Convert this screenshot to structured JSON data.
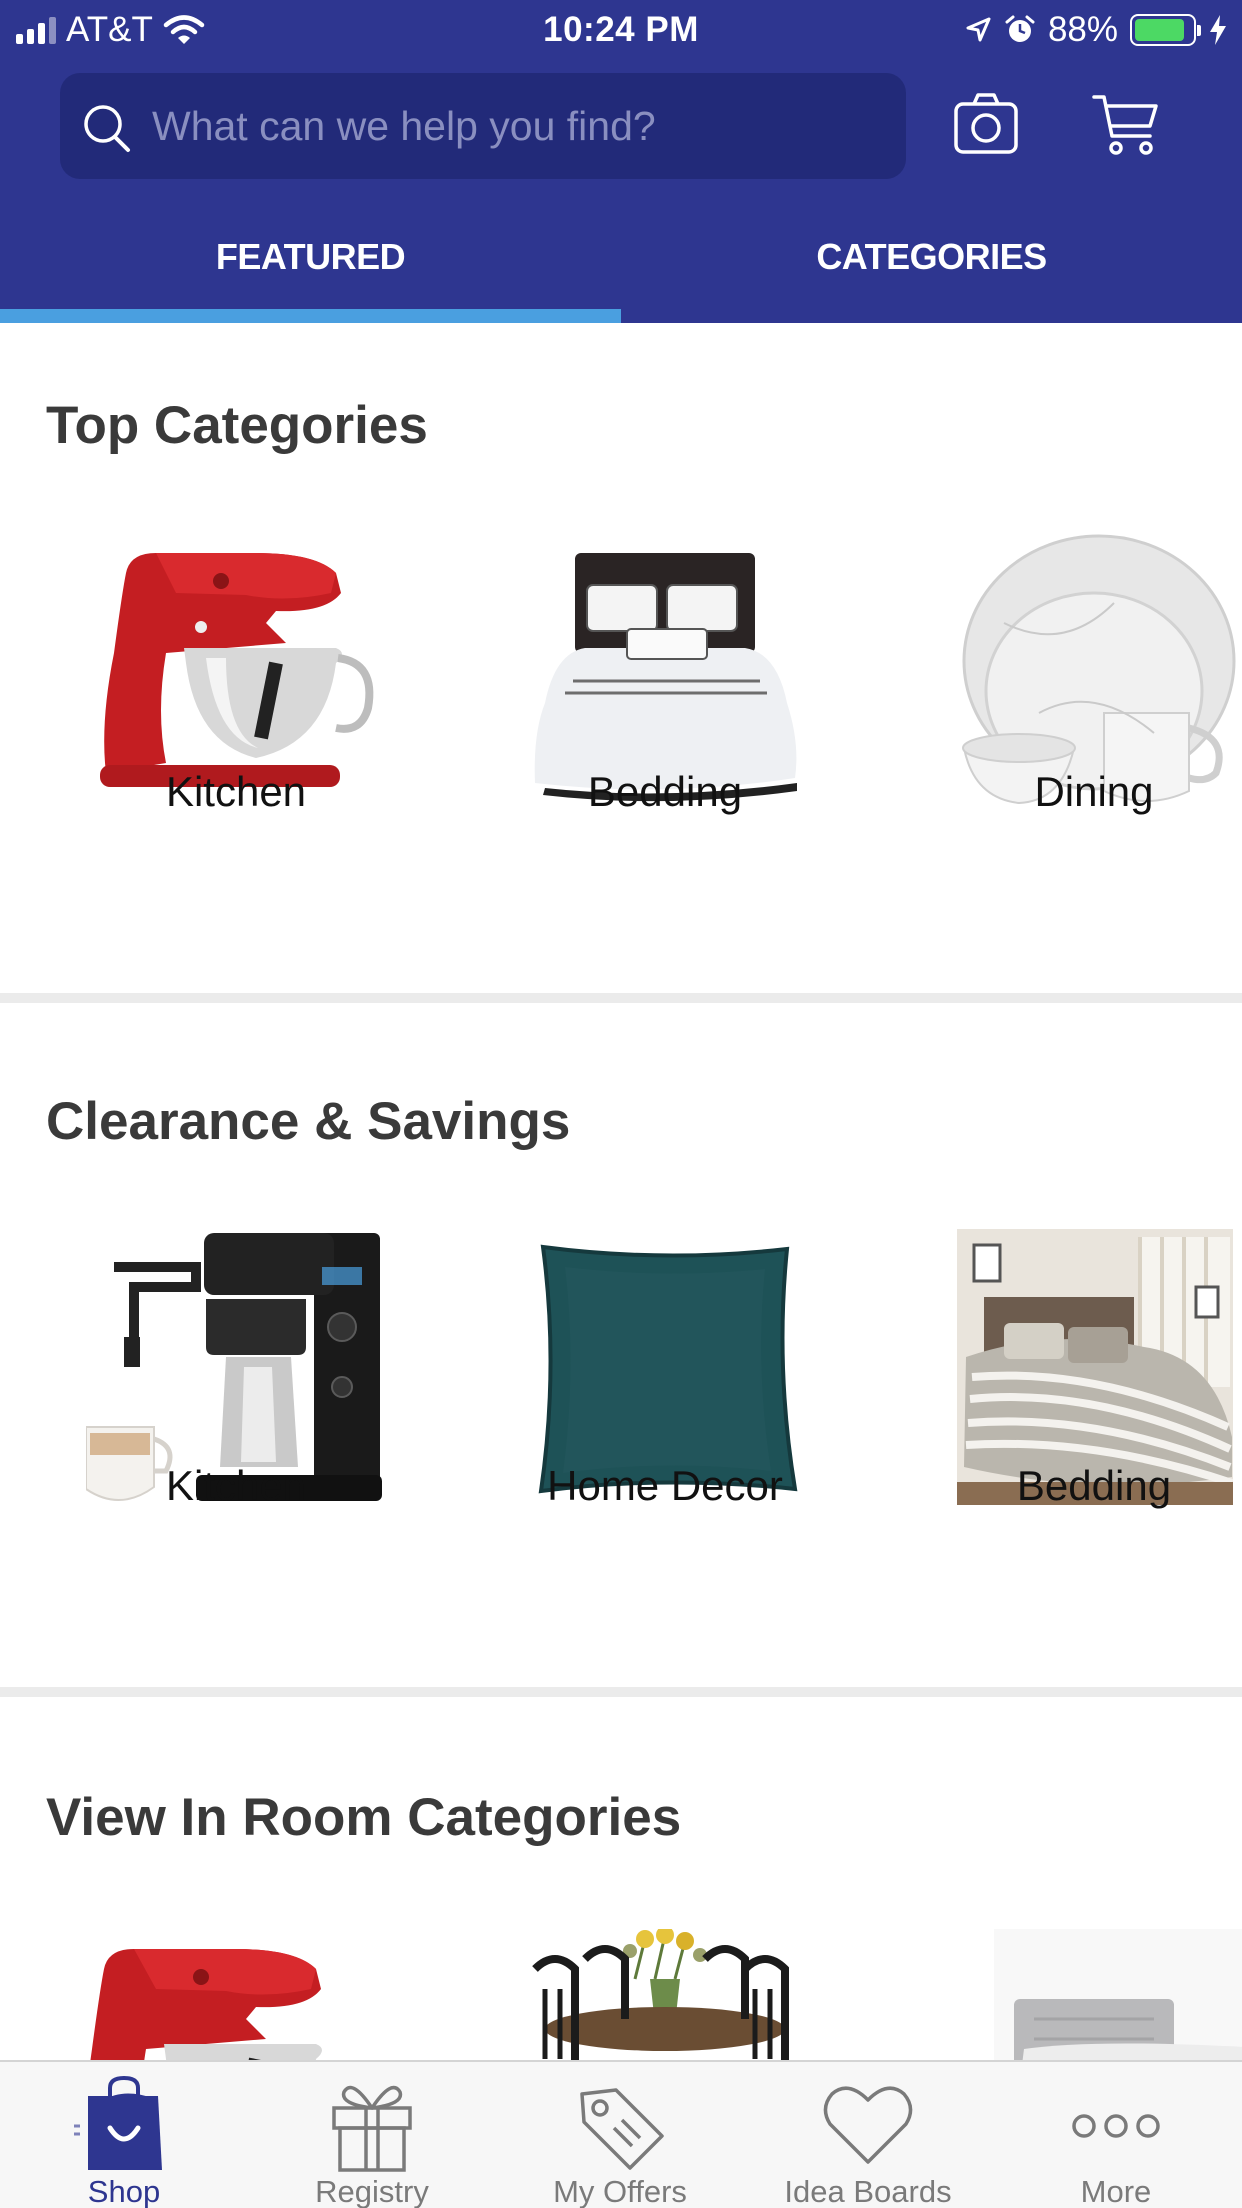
{
  "status_bar": {
    "carrier": "AT&T",
    "time": "10:24 PM",
    "battery_percent": "88%",
    "battery_level": 0.88
  },
  "search": {
    "placeholder": "What can we help you find?"
  },
  "tabs": [
    {
      "label": "FEATURED",
      "active": true
    },
    {
      "label": "CATEGORIES",
      "active": false
    }
  ],
  "sections": {
    "top_categories": {
      "title": "Top Categories",
      "items": [
        {
          "label": "Kitchen",
          "image": "stand-mixer"
        },
        {
          "label": "Bedding",
          "image": "bed"
        },
        {
          "label": "Dining",
          "image": "dinnerware"
        }
      ]
    },
    "clearance": {
      "title": "Clearance & Savings",
      "items": [
        {
          "label": "Kitchen",
          "image": "coffee-maker"
        },
        {
          "label": "Home Decor",
          "image": "pillow"
        },
        {
          "label": "Bedding",
          "image": "bedroom"
        }
      ]
    },
    "view_in_room": {
      "title": "View In Room Categories",
      "items": [
        {
          "image": "stand-mixer"
        },
        {
          "image": "dining-set"
        },
        {
          "image": "headboard-bed"
        }
      ]
    }
  },
  "bottom_nav": [
    {
      "label": "Shop",
      "icon": "shopping-bag-icon",
      "active": true
    },
    {
      "label": "Registry",
      "icon": "gift-icon",
      "active": false
    },
    {
      "label": "My Offers",
      "icon": "tag-icon",
      "active": false
    },
    {
      "label": "Idea Boards",
      "icon": "heart-icon",
      "active": false
    },
    {
      "label": "More",
      "icon": "more-dots-icon",
      "active": false
    }
  ],
  "colors": {
    "brand": "#2e3690",
    "search_bg": "#222a79",
    "tab_indicator": "#4a9fe0"
  }
}
